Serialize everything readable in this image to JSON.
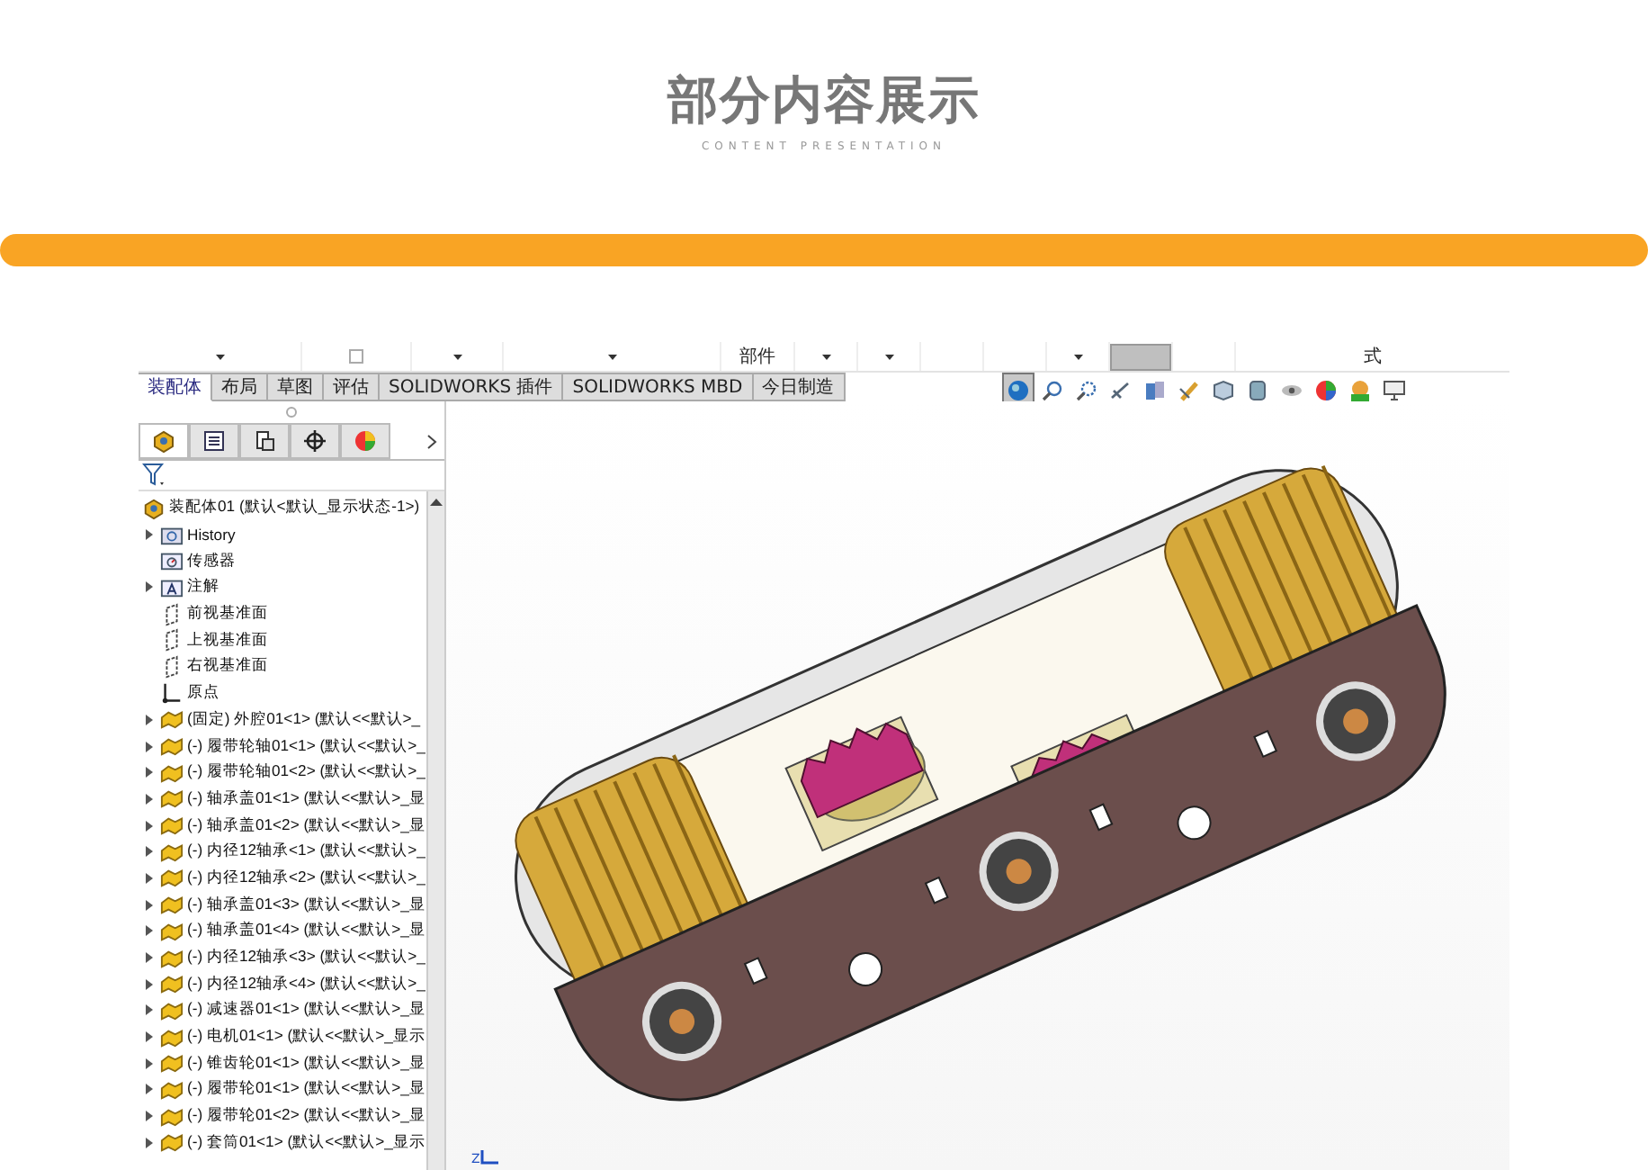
{
  "header": {
    "title": "部分内容展示",
    "subtitle": "CONTENT PRESENTATION"
  },
  "app": {
    "ribbon_top": [
      {
        "kind": "caret"
      },
      {
        "kind": "checkbox",
        "checked": false
      },
      {
        "kind": "caret"
      },
      {
        "kind": "caret"
      },
      {
        "kind": "text",
        "label": "部件"
      },
      {
        "kind": "caret"
      },
      {
        "kind": "caret"
      },
      {
        "kind": "blank"
      },
      {
        "kind": "blank"
      },
      {
        "kind": "caret"
      },
      {
        "kind": "grey"
      },
      {
        "kind": "blank"
      },
      {
        "kind": "text",
        "label": "式"
      }
    ],
    "tabs": [
      {
        "label": "装配体",
        "selected": true
      },
      {
        "label": "布局",
        "selected": false
      },
      {
        "label": "草图",
        "selected": false
      },
      {
        "label": "评估",
        "selected": false
      },
      {
        "label": "SOLIDWORKS 插件",
        "selected": false
      },
      {
        "label": "SOLIDWORKS MBD",
        "selected": false
      },
      {
        "label": "今日制造",
        "selected": false
      }
    ],
    "panel_tabs": [
      {
        "kind": "feature",
        "selected": true
      },
      {
        "kind": "property",
        "selected": false
      },
      {
        "kind": "config",
        "selected": false
      },
      {
        "kind": "dimxpert",
        "selected": false
      },
      {
        "kind": "display",
        "selected": false
      }
    ],
    "view_toolbar": [
      {
        "kind": "sphere",
        "selected": true
      },
      {
        "kind": "zoom",
        "selected": false
      },
      {
        "kind": "zoom-area",
        "selected": false
      },
      {
        "kind": "previous",
        "selected": false
      },
      {
        "kind": "section",
        "selected": false
      },
      {
        "kind": "dynamic",
        "selected": false
      },
      {
        "kind": "orient",
        "selected": false
      },
      {
        "kind": "display",
        "selected": false
      },
      {
        "kind": "hide",
        "selected": false
      },
      {
        "kind": "appearance",
        "selected": false
      },
      {
        "kind": "scene",
        "selected": false
      },
      {
        "kind": "monitor",
        "selected": false
      }
    ],
    "tree": {
      "label": "装配体01 (默认<默认_显示状态-1>)",
      "children": [
        {
          "kind": "history",
          "label": "History",
          "expandable": true
        },
        {
          "kind": "sensor",
          "label": "传感器",
          "expandable": false
        },
        {
          "kind": "annotation",
          "label": "注解",
          "expandable": true
        },
        {
          "kind": "plane",
          "label": "前视基准面",
          "expandable": false
        },
        {
          "kind": "plane",
          "label": "上视基准面",
          "expandable": false
        },
        {
          "kind": "plane",
          "label": "右视基准面",
          "expandable": false
        },
        {
          "kind": "origin",
          "label": "原点",
          "expandable": false
        },
        {
          "kind": "part",
          "label": "(固定) 外腔01<1> (默认<<默认>_",
          "expandable": true
        },
        {
          "kind": "part",
          "label": "(-) 履带轮轴01<1> (默认<<默认>_",
          "expandable": true
        },
        {
          "kind": "part",
          "label": "(-) 履带轮轴01<2> (默认<<默认>_",
          "expandable": true
        },
        {
          "kind": "part",
          "label": "(-) 轴承盖01<1> (默认<<默认>_显",
          "expandable": true
        },
        {
          "kind": "part",
          "label": "(-) 轴承盖01<2> (默认<<默认>_显",
          "expandable": true
        },
        {
          "kind": "part",
          "label": "(-) 内径12轴承<1> (默认<<默认>_",
          "expandable": true
        },
        {
          "kind": "part",
          "label": "(-) 内径12轴承<2> (默认<<默认>_",
          "expandable": true
        },
        {
          "kind": "part",
          "label": "(-) 轴承盖01<3> (默认<<默认>_显",
          "expandable": true
        },
        {
          "kind": "part",
          "label": "(-) 轴承盖01<4> (默认<<默认>_显",
          "expandable": true
        },
        {
          "kind": "part",
          "label": "(-) 内径12轴承<3> (默认<<默认>_",
          "expandable": true
        },
        {
          "kind": "part",
          "label": "(-) 内径12轴承<4> (默认<<默认>_",
          "expandable": true
        },
        {
          "kind": "part",
          "label": "(-) 减速器01<1> (默认<<默认>_显",
          "expandable": true
        },
        {
          "kind": "part",
          "label": "(-) 电机01<1> (默认<<默认>_显示",
          "expandable": true
        },
        {
          "kind": "part",
          "label": "(-) 锥齿轮01<1> (默认<<默认>_显",
          "expandable": true
        },
        {
          "kind": "part",
          "label": "(-) 履带轮01<1> (默认<<默认>_显",
          "expandable": true
        },
        {
          "kind": "part",
          "label": "(-) 履带轮01<2> (默认<<默认>_显",
          "expandable": true
        },
        {
          "kind": "part",
          "label": "(-) 套筒01<1> (默认<<默认>_显示",
          "expandable": true
        }
      ]
    },
    "triad_label": "Z"
  }
}
